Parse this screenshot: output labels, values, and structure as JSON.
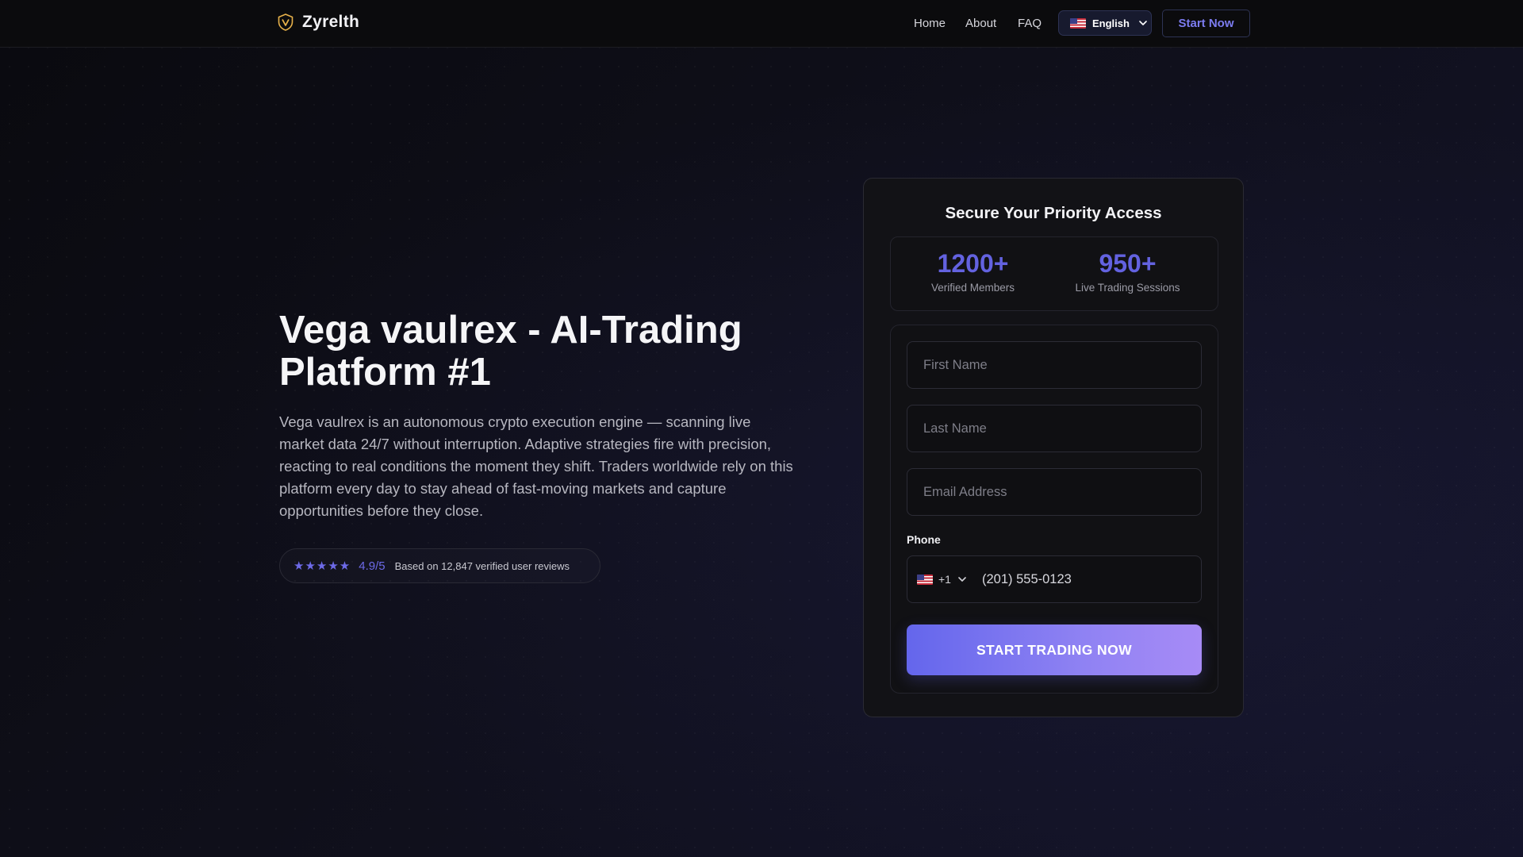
{
  "header": {
    "brand": "Zyrelth",
    "nav": [
      "Home",
      "About",
      "FAQ"
    ],
    "language": "English",
    "cta_label": "Start Now"
  },
  "hero": {
    "title": "Vega vaulrex - AI-Trading Platform #1",
    "description": "Vega vaulrex is an autonomous crypto execution engine — scanning live market data 24/7 without interruption. Adaptive strategies fire with precision, reacting to real conditions the moment they shift. Traders worldwide rely on this platform every day to stay ahead of fast-moving markets and capture opportunities before they close.",
    "rating": {
      "stars": "★★★★★",
      "score": "4.9/5",
      "reviews": "Based on 12,847 verified user reviews"
    }
  },
  "card": {
    "title": "Secure Your Priority Access",
    "stats": [
      {
        "value": "1200+",
        "label": "Verified Members"
      },
      {
        "value": "950+",
        "label": "Live Trading Sessions"
      }
    ],
    "form": {
      "first_name_placeholder": "First Name",
      "last_name_placeholder": "Last Name",
      "email_placeholder": "Email Address",
      "phone_label": "Phone",
      "country_code": "+1",
      "phone_placeholder": "(201) 555-0123",
      "submit_label": "START TRADING NOW"
    }
  },
  "colors": {
    "accent": "#6362e0",
    "cta_start": "#6466ec",
    "cta_end": "#a78bf6",
    "background": "#0b0b12"
  },
  "icons": {
    "brand": "shield-logo-icon",
    "flag": "us-flag-icon",
    "dropdown": "chevron-down-icon"
  }
}
